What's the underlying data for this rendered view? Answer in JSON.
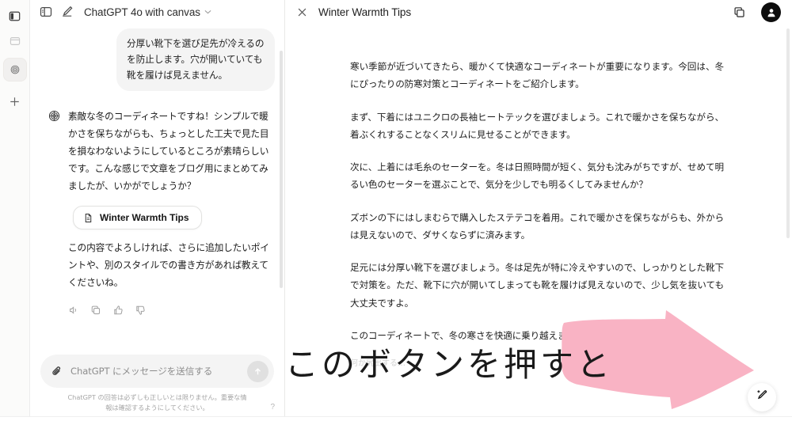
{
  "rail": {
    "items": [
      {
        "name": "panel-toggle",
        "icon": "sidebar-panel-icon"
      },
      {
        "name": "history",
        "icon": "window-icon"
      },
      {
        "name": "gpt-explore",
        "icon": "openai-logo-icon"
      },
      {
        "name": "new",
        "icon": "plus-icon"
      }
    ]
  },
  "chat": {
    "header": {
      "sidebar_toggle_icon": "sidebar-toggle-icon",
      "new_chat_icon": "new-chat-pencil-icon",
      "model_title": "ChatGPT 4o with canvas",
      "chevron": "∨"
    },
    "user_message": "分厚い靴下を選び足先が冷えるのを防止します。穴が開いていても靴を履けば見えません。",
    "assistant_message": "素敵な冬のコーディネートですね！シンプルで暖かさを保ちながらも、ちょっとした工夫で見た目を損なわないようにしているところが素晴らしいです。こんな感じで文章をブログ用にまとめてみましたが、いかがでしょうか？",
    "canvas_chip": {
      "label": "Winter Warmth Tips",
      "icon": "document-icon"
    },
    "assistant_followup": "この内容でよろしければ、さらに追加したいポイントや、別のスタイルでの書き方があれば教えてくださいね。",
    "actions": [
      {
        "name": "read-aloud",
        "icon": "speaker-icon"
      },
      {
        "name": "copy",
        "icon": "copy-icon"
      },
      {
        "name": "thumbs-up",
        "icon": "thumbs-up-icon"
      },
      {
        "name": "thumbs-down",
        "icon": "thumbs-down-icon"
      }
    ],
    "composer": {
      "attach_icon": "paperclip-icon",
      "placeholder": "ChatGPT にメッセージを送信する",
      "send_icon": "arrow-up-icon"
    },
    "disclaimer": "ChatGPT の回答は必ずしも正しいとは限りません。重要な情報は確認するようにしてください。",
    "help_badge": "?"
  },
  "canvas": {
    "close_icon": "close-x-icon",
    "title": "Winter Warmth Tips",
    "copy_icon": "copy-icon",
    "avatar_icon": "user-avatar-icon",
    "paragraphs": [
      "寒い季節が近づいてきたら、暖かくて快適なコーディネートが重要になります。今回は、冬にぴったりの防寒対策とコーディネートをご紹介します。",
      "まず、下着にはユニクロの長袖ヒートテックを選びましょう。これで暖かさを保ちながら、着ぶくれすることなくスリムに見せることができます。",
      "次に、上着には毛糸のセーターを。冬は日照時間が短く、気分も沈みがちですが、せめて明るい色のセーターを選ぶことで、気分を少しでも明るくしてみませんか？",
      "ズボンの下にはしまむらで購入したステテコを着用。これで暖かさを保ちながらも、外からは見えないので、ダサくならずに済みます。",
      "足元には分厚い靴下を選びましょう。冬は足先が特に冷えやすいので、しっかりとした靴下で対策を。ただ、靴下に穴が開いてしまっても靴を履けば見えないので、少し気を抜いても大丈夫ですよ。",
      "このコーディネートで、冬の寒さを快適に乗り越えましょう！"
    ],
    "next_line_placeholder": "何か尻出する…",
    "edit_fab_icon": "magic-pencil-icon"
  },
  "annotation": {
    "caption": "このボタンを押すと",
    "arrow_color": "#f9b3c4",
    "arrow_name": "pink-arrow-annotation"
  }
}
